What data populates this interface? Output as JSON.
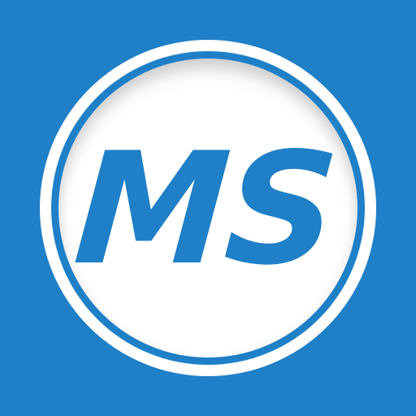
{
  "app_icon": {
    "monogram": "MS",
    "colors": {
      "background": "#1f7fc7",
      "ring": "#ffffff",
      "disc": "#ffffff",
      "text": "#1f7fc7"
    }
  }
}
